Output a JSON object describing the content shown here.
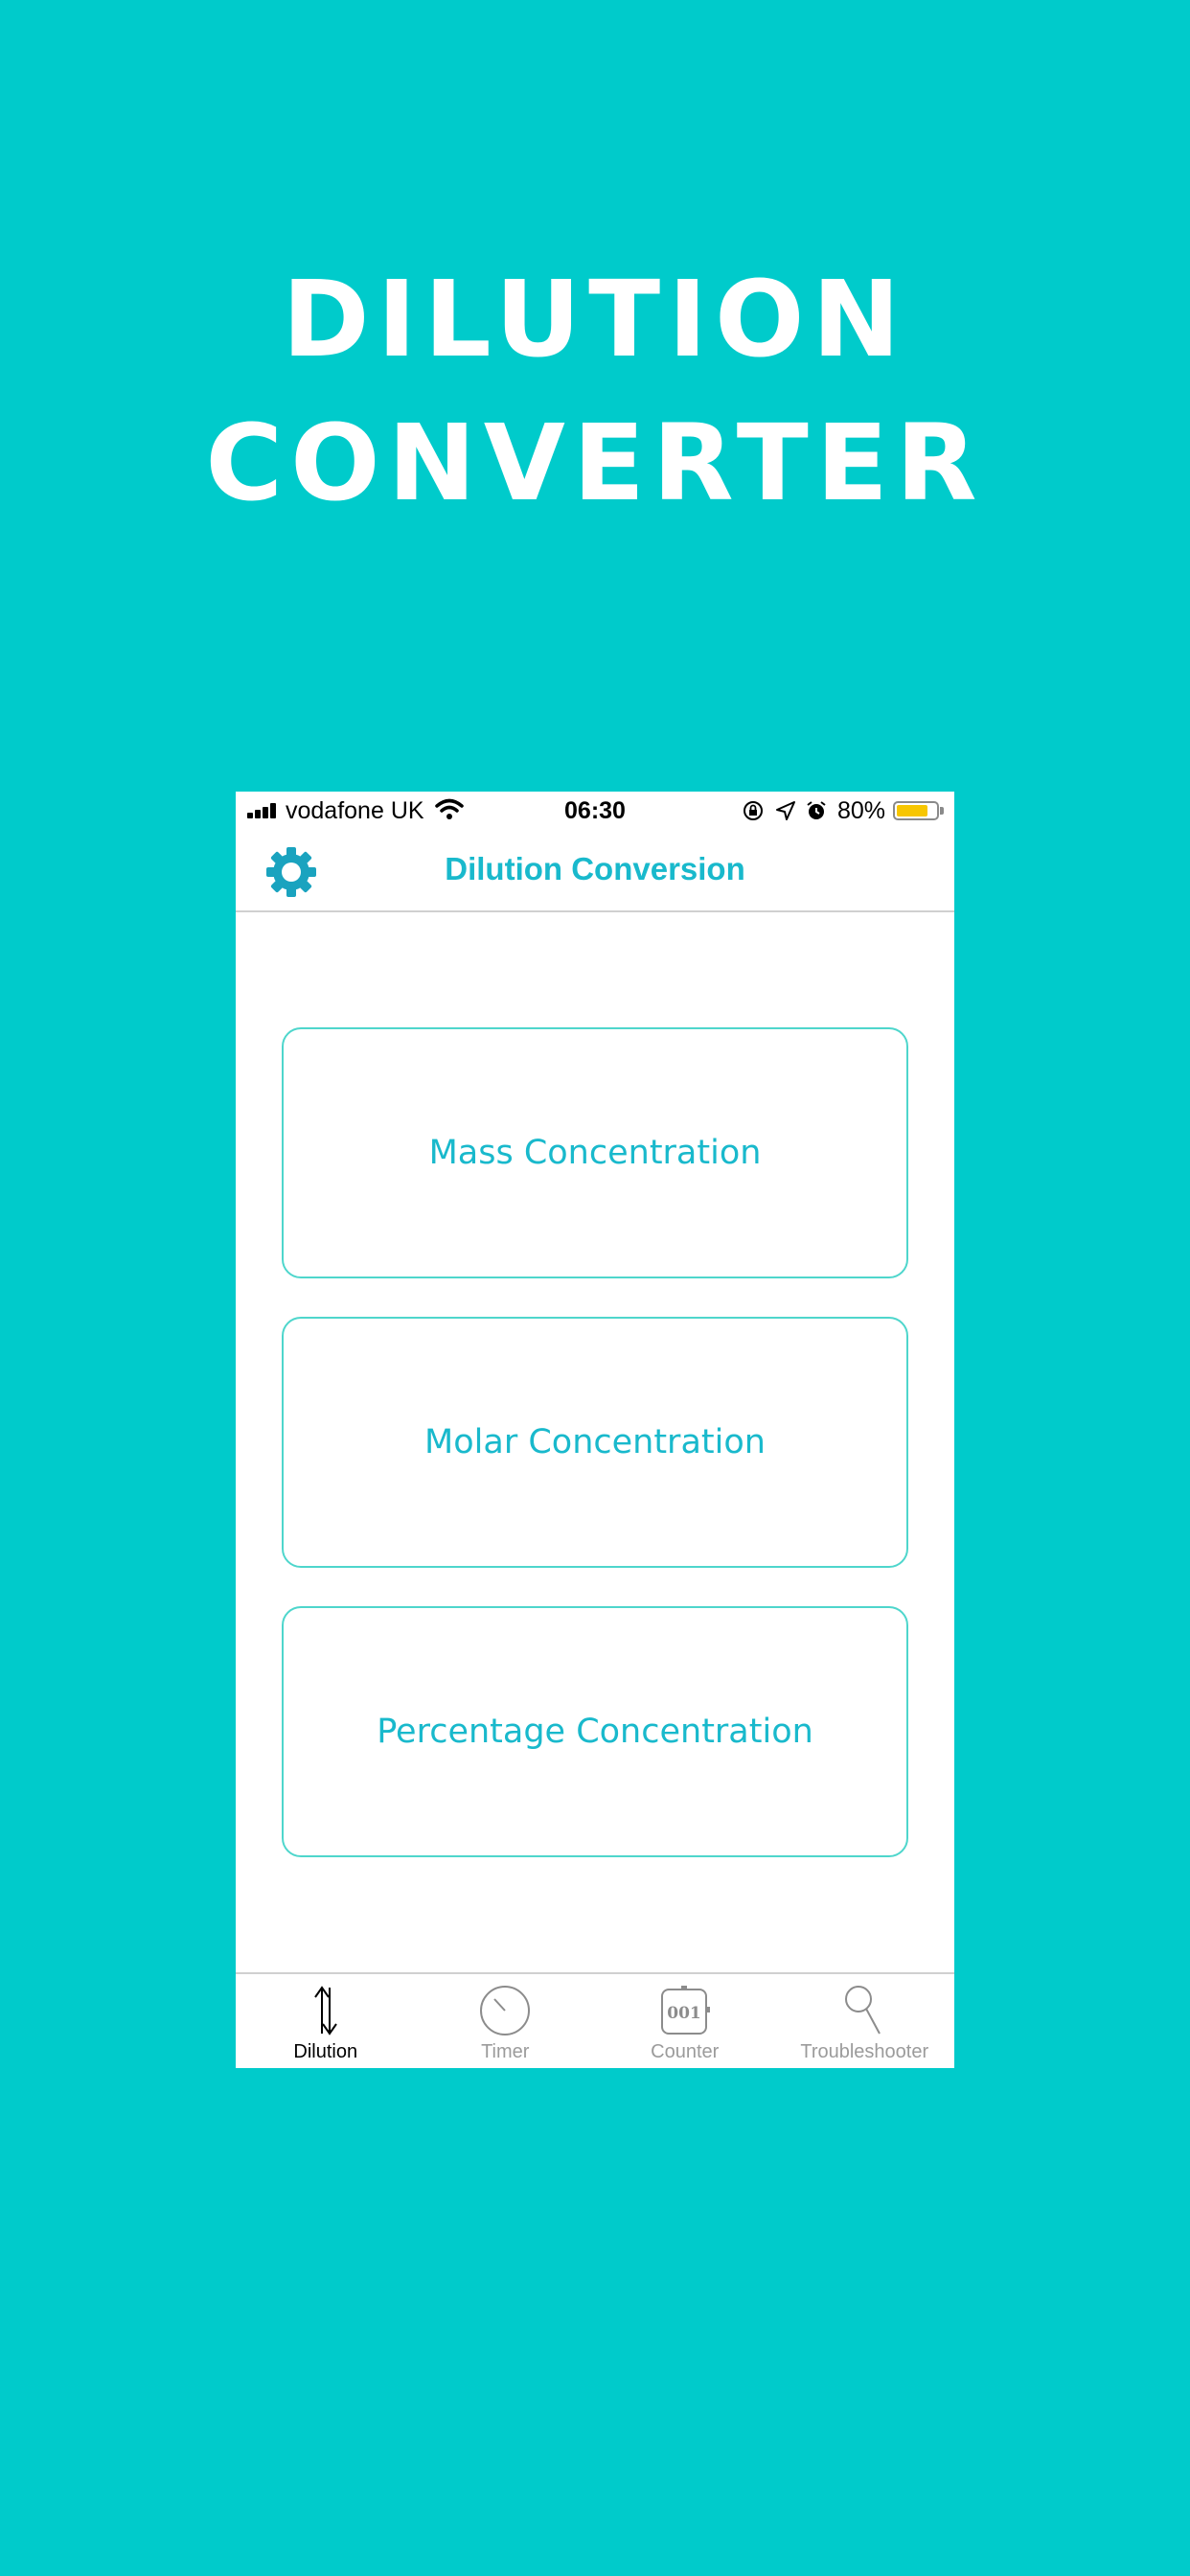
{
  "promo": {
    "title_line1": "DILUTION",
    "title_line2": "CONVERTER",
    "background_color": "#00cbcb"
  },
  "status_bar": {
    "carrier": "vodafone UK",
    "time": "06:30",
    "battery_percent_label": "80%",
    "battery_level": 0.8,
    "icons": [
      "signal-icon",
      "wifi-icon",
      "orientation-lock-icon",
      "location-icon",
      "alarm-icon",
      "battery-icon"
    ]
  },
  "nav_bar": {
    "title": "Dilution Conversion",
    "settings_icon": "gear-icon",
    "accent_color": "#19b9cc"
  },
  "options": [
    {
      "label": "Mass Concentration"
    },
    {
      "label": "Molar Concentration"
    },
    {
      "label": "Percentage Concentration"
    }
  ],
  "tab_bar": {
    "tabs": [
      {
        "label": "Dilution",
        "icon": "up-down-arrows-icon",
        "active": true
      },
      {
        "label": "Timer",
        "icon": "timer-icon",
        "active": false
      },
      {
        "label": "Counter",
        "icon": "counter-icon",
        "active": false
      },
      {
        "label": "Troubleshooter",
        "icon": "magnifier-icon",
        "active": false
      }
    ]
  }
}
